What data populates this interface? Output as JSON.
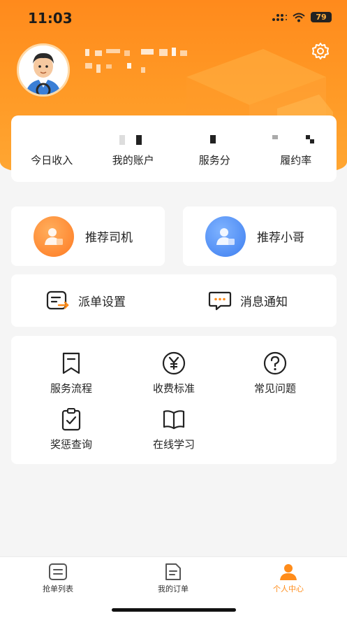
{
  "status_bar": {
    "time": "11:03",
    "battery": "79"
  },
  "theme": {
    "accent": "#ff8c1a",
    "header_gradient_top": "#ff8a1c",
    "orange_circle": "#ff8a2e",
    "blue_circle": "#4a8cf7"
  },
  "profile": {
    "avatar_icon": "driver-avatar",
    "settings_icon": "gear-icon"
  },
  "stats": [
    {
      "label": "今日收入"
    },
    {
      "label": "我的账户"
    },
    {
      "label": "服务分"
    },
    {
      "label": "履约率"
    }
  ],
  "referrals": {
    "driver": {
      "label": "推荐司机",
      "icon": "person-icon"
    },
    "courier": {
      "label": "推荐小哥",
      "icon": "person-icon"
    }
  },
  "settings": {
    "dispatch": {
      "label": "派单设置",
      "icon": "dispatch-settings-icon"
    },
    "messages": {
      "label": "消息通知",
      "icon": "message-icon"
    }
  },
  "tools": [
    {
      "label": "服务流程",
      "icon": "bookmark-icon"
    },
    {
      "label": "收费标准",
      "icon": "yen-icon"
    },
    {
      "label": "常见问题",
      "icon": "question-icon"
    },
    {
      "label": "奖惩查询",
      "icon": "clipboard-check-icon"
    },
    {
      "label": "在线学习",
      "icon": "book-icon"
    }
  ],
  "tabbar": {
    "tabs": [
      {
        "label": "抢单列表",
        "icon": "list-icon",
        "active": false
      },
      {
        "label": "我的订单",
        "icon": "order-icon",
        "active": false
      },
      {
        "label": "个人中心",
        "icon": "user-icon",
        "active": true
      }
    ]
  }
}
